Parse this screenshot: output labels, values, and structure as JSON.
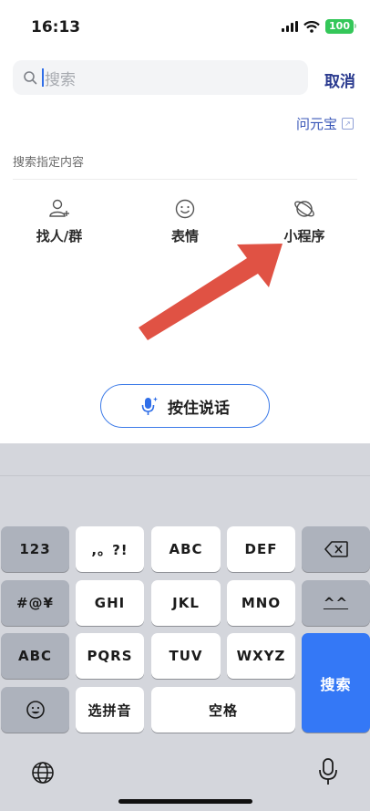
{
  "status_bar": {
    "time": "16:13",
    "battery": "100"
  },
  "search": {
    "placeholder": "搜索",
    "cancel_label": "取消"
  },
  "ask_yuanbao": {
    "label": "问元宝"
  },
  "section": {
    "label": "搜索指定内容"
  },
  "categories": [
    {
      "label": "找人/群",
      "icon": "add-person-icon"
    },
    {
      "label": "表情",
      "icon": "smiley-icon"
    },
    {
      "label": "小程序",
      "icon": "mini-program-icon"
    }
  ],
  "voice": {
    "label": "按住说话",
    "icon": "microphone-icon"
  },
  "keyboard": {
    "row1": [
      "123",
      ",。?!",
      "ABC",
      "DEF"
    ],
    "row2": [
      "#@¥",
      "GHI",
      "JKL",
      "MNO",
      "^^"
    ],
    "row3": [
      "ABC",
      "PQRS",
      "TUV",
      "WXYZ"
    ],
    "row4": [
      "选拼音",
      "空格"
    ],
    "search_label": "搜索"
  },
  "colors": {
    "accent": "#3478f6",
    "cancel": "#2a3a8f",
    "arrow": "#e05244"
  }
}
